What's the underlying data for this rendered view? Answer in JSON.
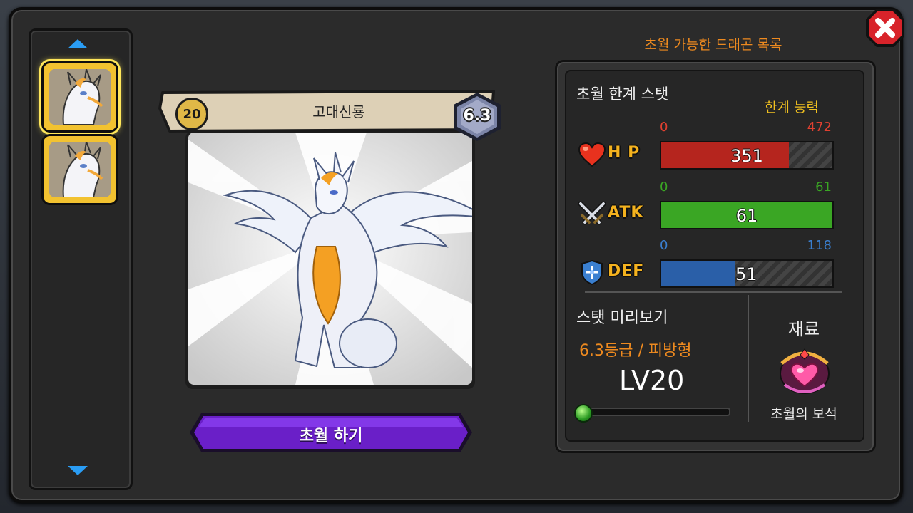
{
  "window": {
    "close_icon": "close-x-icon"
  },
  "sidebar": {
    "scroll_up_icon": "triangle-up-icon",
    "scroll_down_icon": "triangle-down-icon",
    "items": [
      {
        "icon": "white-dragon-portrait",
        "selected": true
      },
      {
        "icon": "white-dragon-portrait",
        "selected": false
      }
    ]
  },
  "card": {
    "level": "20",
    "name": "고대신룡",
    "grade": "6.3",
    "action_button": "초월 하기"
  },
  "panel": {
    "title": "초월 가능한 드래곤 목록",
    "stats_title": "초월 한계 스탯",
    "limit_label": "한계 능력",
    "stats": [
      {
        "name": "H P",
        "icon": "heart-icon",
        "min": "0",
        "max": "472",
        "value": "351",
        "fraction": 0.744,
        "color": "#b5251e",
        "min_color": "#e04030",
        "max_color": "#e04030"
      },
      {
        "name": "ATK",
        "icon": "crossed-swords-icon",
        "min": "0",
        "max": "61",
        "value": "61",
        "fraction": 1.0,
        "color": "#3aa624",
        "min_color": "#3aa624",
        "max_color": "#3aa624"
      },
      {
        "name": "DEF",
        "icon": "shield-icon",
        "min": "0",
        "max": "118",
        "value": "51",
        "fraction": 0.432,
        "color": "#2a5fa8",
        "min_color": "#3a7fd0",
        "max_color": "#3a7fd0"
      }
    ],
    "preview": {
      "title": "스탯 미리보기",
      "grade_type": "6.3등급 / 피방형",
      "level": "LV20",
      "exp_fraction": 0.0
    },
    "material": {
      "title": "재료",
      "icon": "transcendence-gem-icon",
      "name": "초월의 보석"
    }
  }
}
